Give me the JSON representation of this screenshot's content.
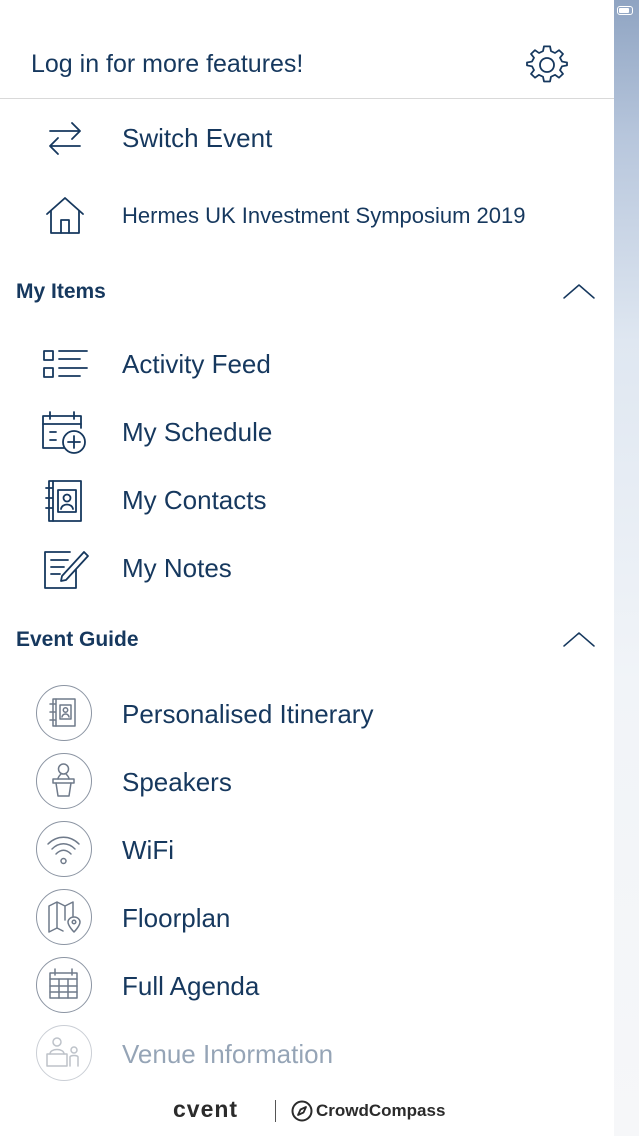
{
  "header": {
    "title": "Log in for more features!",
    "settings_icon": "gear-icon"
  },
  "top_items": [
    {
      "label": "Switch Event",
      "icon": "switch-arrows-icon"
    },
    {
      "label": "Hermes UK Investment Symposium 2019",
      "icon": "home-icon"
    }
  ],
  "my_items": {
    "title": "My Items",
    "items": [
      {
        "label": "Activity Feed",
        "icon": "list-icon"
      },
      {
        "label": "My Schedule",
        "icon": "calendar-add-icon"
      },
      {
        "label": "My Contacts",
        "icon": "contact-book-icon"
      },
      {
        "label": "My Notes",
        "icon": "note-pencil-icon"
      }
    ]
  },
  "event_guide": {
    "title": "Event Guide",
    "items": [
      {
        "label": "Personalised Itinerary",
        "icon": "itinerary-book-icon"
      },
      {
        "label": "Speakers",
        "icon": "speaker-podium-icon"
      },
      {
        "label": "WiFi",
        "icon": "wifi-icon"
      },
      {
        "label": "Floorplan",
        "icon": "map-pin-icon"
      },
      {
        "label": "Full Agenda",
        "icon": "calendar-grid-icon"
      },
      {
        "label": "Venue Information",
        "icon": "reception-desk-icon"
      }
    ]
  },
  "footer": {
    "brand_cvent": "cvent",
    "brand_crowdcompass": "CrowdCompass"
  },
  "colors": {
    "text_primary": "#16385e",
    "icon_gray": "#6f7a8a"
  }
}
